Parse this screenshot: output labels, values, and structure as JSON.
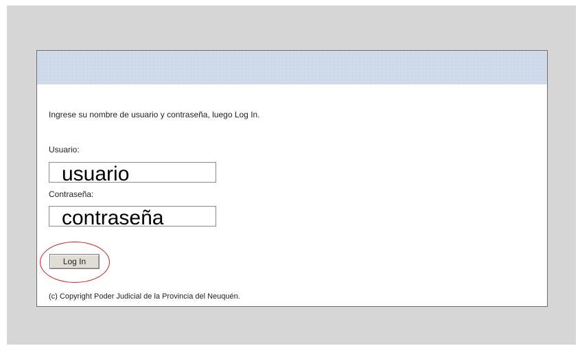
{
  "instructions": "Ingrese su nombre de usuario y contraseña, luego Log In.",
  "username": {
    "label": "Usuario:",
    "value": "usuario"
  },
  "password": {
    "label": "Contraseña:",
    "value": "contraseña"
  },
  "login_button": "Log In",
  "copyright": "(c) Copyright Poder Judicial de la Provincia del Neuquén.",
  "colors": {
    "banner": "#b9c9e0",
    "highlight": "#d32020",
    "backdrop": "#d6d6d6"
  }
}
